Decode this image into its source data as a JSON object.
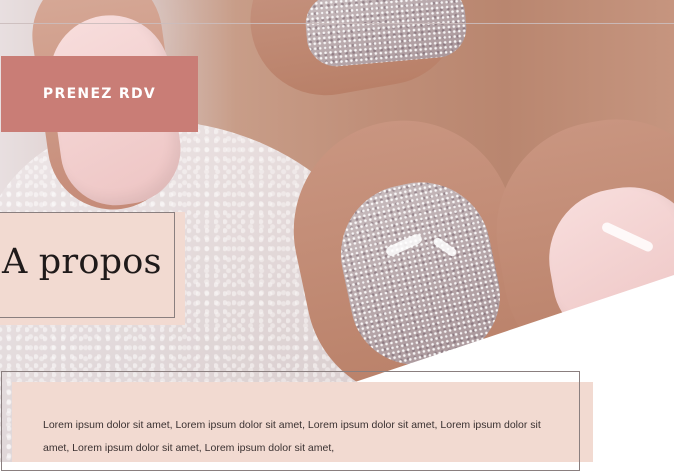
{
  "hero": {
    "cta_label": "PRENEZ RDV"
  },
  "about": {
    "title": "A propos",
    "body": "Lorem ipsum dolor sit amet, Lorem ipsum dolor sit amet, Lorem ipsum dolor sit amet, Lorem ipsum dolor sit amet, Lorem ipsum dolor sit amet, Lorem ipsum dolor sit amet,"
  },
  "colors": {
    "accent": "#c97d76",
    "card_background": "#f2dad1",
    "border": "#8a7f7f"
  }
}
